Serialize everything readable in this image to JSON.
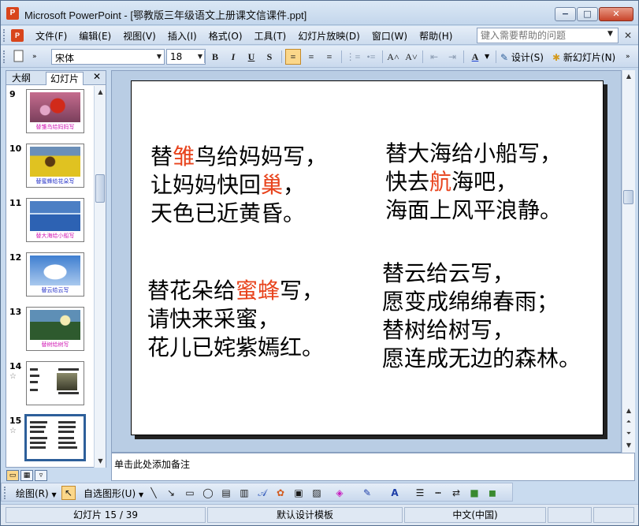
{
  "window": {
    "title": "Microsoft PowerPoint - [鄂教版三年级语文上册课文信课件.ppt]",
    "app_icon_letter": "P",
    "minimize_glyph": "−",
    "maximize_glyph": "□",
    "close_glyph": "✕"
  },
  "menubar": {
    "items": [
      "文件(F)",
      "编辑(E)",
      "视图(V)",
      "插入(I)",
      "格式(O)",
      "工具(T)",
      "幻灯片放映(D)",
      "窗口(W)",
      "帮助(H)"
    ],
    "help_placeholder": "键入需要帮助的问题",
    "close_glyph": "✕"
  },
  "toolbar": {
    "font_name": "宋体",
    "font_size": "18",
    "bold": "B",
    "italic": "I",
    "underline": "U",
    "shadow": "S",
    "align_left": "≡",
    "align_center": "≡",
    "align_right": "≡",
    "numbering": "⋮≡",
    "bullets": "•≡",
    "grow_font": "A˄",
    "shrink_font": "A˅",
    "decrease_indent": "⇤",
    "increase_indent": "⇥",
    "font_color": "A",
    "design_label": "设计(S)",
    "new_slide_label": "新幻灯片(N)"
  },
  "left_pane": {
    "tab_outline": "大纲",
    "tab_slides": "幻灯片",
    "close_glyph": "✕",
    "slides": [
      {
        "number": "9",
        "caption": "替雏鸟给妈妈写",
        "caption_color": "#d21cb5",
        "photo": "bird",
        "star": ""
      },
      {
        "number": "10",
        "caption": "替蜜蜂给花朵写",
        "caption_color": "#2430c8",
        "photo": "flowers",
        "star": ""
      },
      {
        "number": "11",
        "caption": "替大海给小船写",
        "caption_color": "#d21cb5",
        "photo": "sea",
        "star": ""
      },
      {
        "number": "12",
        "caption": "替云给云写",
        "caption_color": "#2430c8",
        "photo": "clouds",
        "star": ""
      },
      {
        "number": "13",
        "caption": "替树给树写",
        "caption_color": "#d21cb5",
        "photo": "forest",
        "star": ""
      },
      {
        "number": "14",
        "caption": "",
        "caption_color": "#333333",
        "photo": "text",
        "star": "☆"
      },
      {
        "number": "15",
        "caption": "",
        "caption_color": "#333333",
        "photo": "text",
        "star": "☆"
      }
    ]
  },
  "slide": {
    "poems": [
      {
        "lines": [
          [
            {
              "t": "替"
            },
            {
              "t": "雏",
              "hl": true
            },
            {
              "t": "鸟给妈妈写，"
            }
          ],
          [
            {
              "t": "让妈妈快回"
            },
            {
              "t": "巢",
              "hl": true
            },
            {
              "t": "，"
            }
          ],
          [
            {
              "t": "天色已近黄昏。"
            }
          ]
        ]
      },
      {
        "lines": [
          [
            {
              "t": "替大海给小船写，"
            }
          ],
          [
            {
              "t": "快去"
            },
            {
              "t": "航",
              "hl": true
            },
            {
              "t": "海吧，"
            }
          ],
          [
            {
              "t": "海面上风平浪静。"
            }
          ]
        ]
      },
      {
        "lines": [
          [
            {
              "t": "替花朵给"
            },
            {
              "t": "蜜蜂",
              "hl": true
            },
            {
              "t": "写，"
            }
          ],
          [
            {
              "t": "请快来采蜜，"
            }
          ],
          [
            {
              "t": "花儿已姹紫嫣红。"
            }
          ]
        ]
      },
      {
        "lines": [
          [
            {
              "t": "替云给云写，"
            }
          ],
          [
            {
              "t": "愿变成绵绵春雨；"
            }
          ],
          [
            {
              "t": "替树给树写，"
            }
          ],
          [
            {
              "t": "愿连成无边的森林。"
            }
          ]
        ]
      }
    ],
    "highlight_color": "#e8431c"
  },
  "notes": {
    "placeholder": "单击此处添加备注"
  },
  "drawbar": {
    "draw_label": "绘图(R)",
    "autoshapes_label": "自选图形(U)"
  },
  "status": {
    "slide_position": "幻灯片 15 / 39",
    "template": "默认设计模板",
    "language": "中文(中国)"
  }
}
